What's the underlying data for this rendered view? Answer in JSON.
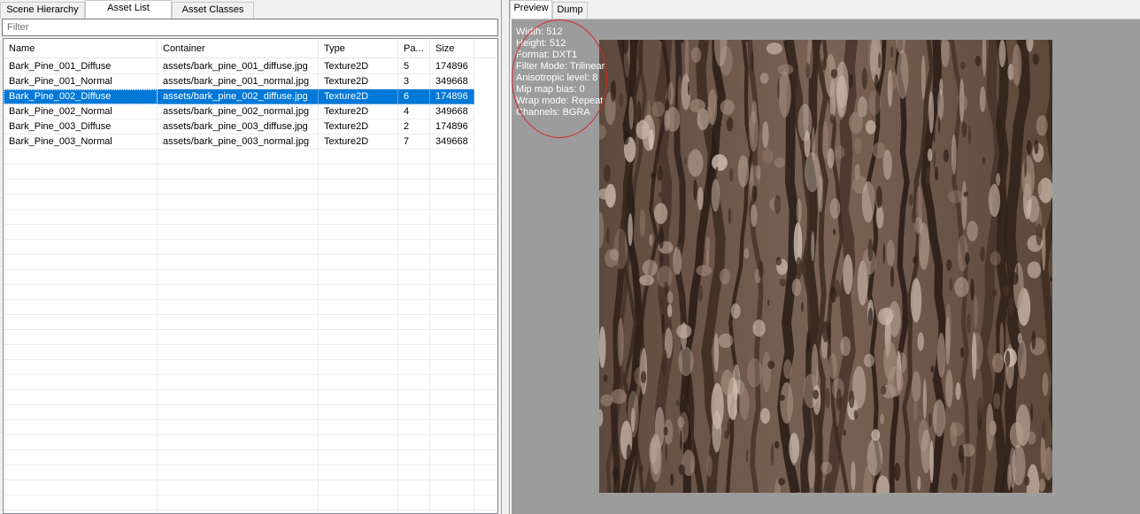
{
  "left_tabs": [
    {
      "label": "Scene Hierarchy"
    },
    {
      "label": "Asset List"
    },
    {
      "label": "Asset Classes"
    }
  ],
  "active_left_tab": "Asset List",
  "filter": {
    "placeholder": "Filter",
    "value": ""
  },
  "grid": {
    "columns": [
      "Name",
      "Container",
      "Type",
      "Pa...",
      "Size"
    ],
    "rows": [
      {
        "name": "Bark_Pine_001_Diffuse",
        "container": "assets/bark_pine_001_diffuse.jpg",
        "type": "Texture2D",
        "path_id": "5",
        "size": "174896"
      },
      {
        "name": "Bark_Pine_001_Normal",
        "container": "assets/bark_pine_001_normal.jpg",
        "type": "Texture2D",
        "path_id": "3",
        "size": "349668"
      },
      {
        "name": "Bark_Pine_002_Diffuse",
        "container": "assets/bark_pine_002_diffuse.jpg",
        "type": "Texture2D",
        "path_id": "6",
        "size": "174896",
        "selected": true
      },
      {
        "name": "Bark_Pine_002_Normal",
        "container": "assets/bark_pine_002_normal.jpg",
        "type": "Texture2D",
        "path_id": "4",
        "size": "349668"
      },
      {
        "name": "Bark_Pine_003_Diffuse",
        "container": "assets/bark_pine_003_diffuse.jpg",
        "type": "Texture2D",
        "path_id": "2",
        "size": "174896"
      },
      {
        "name": "Bark_Pine_003_Normal",
        "container": "assets/bark_pine_003_normal.jpg",
        "type": "Texture2D",
        "path_id": "7",
        "size": "349668"
      }
    ]
  },
  "right_tabs": [
    {
      "label": "Preview"
    },
    {
      "label": "Dump"
    }
  ],
  "active_right_tab": "Preview",
  "texture_info": [
    "Width: 512",
    "Height: 512",
    "Format: DXT1",
    "Filter Mode: Trilinear",
    "Anisotropic level: 8",
    "Mip map bias: 0",
    "Wrap mode: Repeat",
    "Channels: BGRA"
  ],
  "colors": {
    "selection": "#0078d7",
    "preview_background": "#9c9c9c",
    "annotation": "#d42a2a",
    "bark_base": "#6b5646"
  }
}
